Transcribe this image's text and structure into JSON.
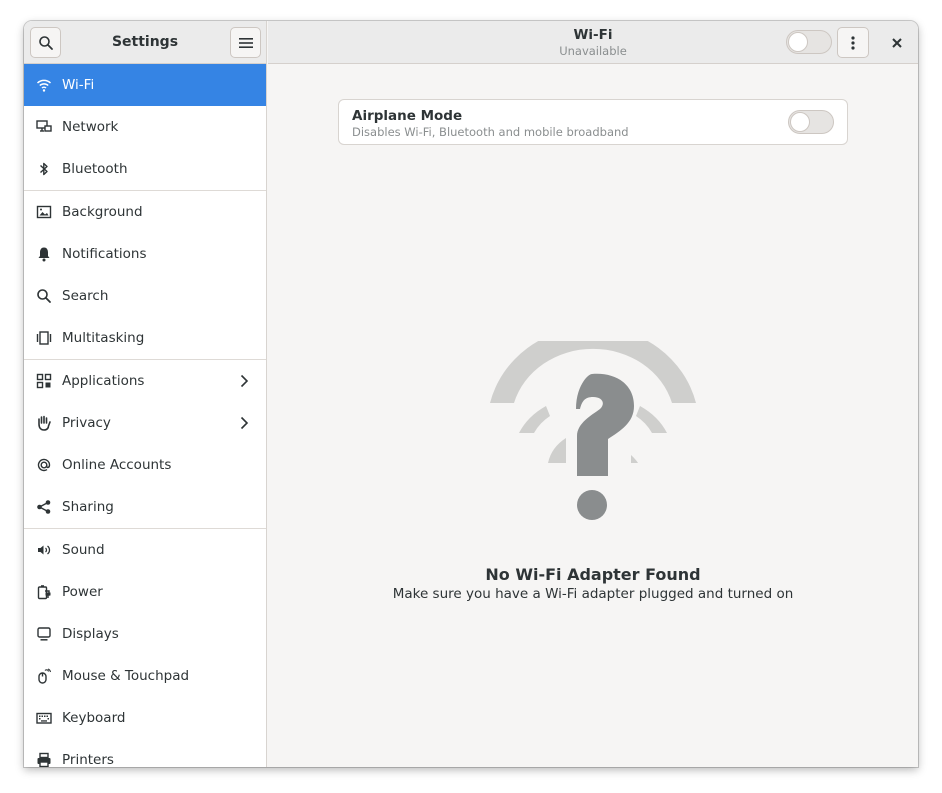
{
  "sidebar": {
    "title": "Settings",
    "items": [
      {
        "label": "Wi-Fi",
        "icon": "wifi-icon"
      },
      {
        "label": "Network",
        "icon": "network-icon"
      },
      {
        "label": "Bluetooth",
        "icon": "bluetooth-icon"
      },
      {
        "label": "Background",
        "icon": "background-icon"
      },
      {
        "label": "Notifications",
        "icon": "bell-icon"
      },
      {
        "label": "Search",
        "icon": "search-icon"
      },
      {
        "label": "Multitasking",
        "icon": "multitasking-icon"
      },
      {
        "label": "Applications",
        "icon": "apps-grid-icon"
      },
      {
        "label": "Privacy",
        "icon": "hand-icon"
      },
      {
        "label": "Online Accounts",
        "icon": "at-sign-icon"
      },
      {
        "label": "Sharing",
        "icon": "share-icon"
      },
      {
        "label": "Sound",
        "icon": "speaker-icon"
      },
      {
        "label": "Power",
        "icon": "power-icon"
      },
      {
        "label": "Displays",
        "icon": "display-icon"
      },
      {
        "label": "Mouse & Touchpad",
        "icon": "mouse-icon"
      },
      {
        "label": "Keyboard",
        "icon": "keyboard-icon"
      },
      {
        "label": "Printers",
        "icon": "printer-icon"
      }
    ]
  },
  "header": {
    "title": "Wi-Fi",
    "subtitle": "Unavailable",
    "wifi_switch_on": false
  },
  "airplane": {
    "title": "Airplane Mode",
    "subtitle": "Disables Wi-Fi, Bluetooth and mobile broadband",
    "switch_on": false
  },
  "empty_state": {
    "title": "No Wi-Fi Adapter Found",
    "subtitle": "Make sure you have a Wi-Fi adapter plugged and turned on",
    "icon": "wifi-question-icon"
  },
  "colors": {
    "accent": "#3584e4",
    "text": "#2e3436",
    "dim": "#8a8e8f"
  }
}
